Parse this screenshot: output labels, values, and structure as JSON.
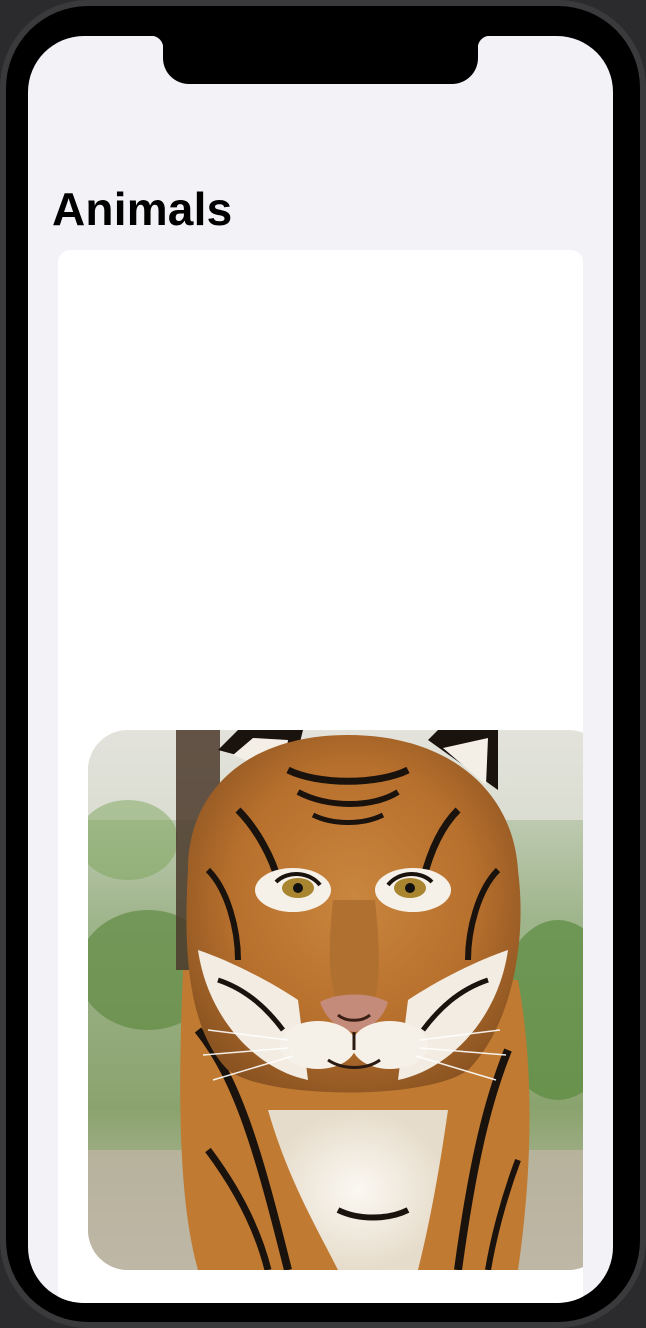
{
  "screen": {
    "title": "Animals"
  },
  "card": {
    "image": {
      "subject": "tiger-photo"
    }
  },
  "colors": {
    "background": "#f2f2f7",
    "card": "#ffffff",
    "title": "#000000"
  }
}
